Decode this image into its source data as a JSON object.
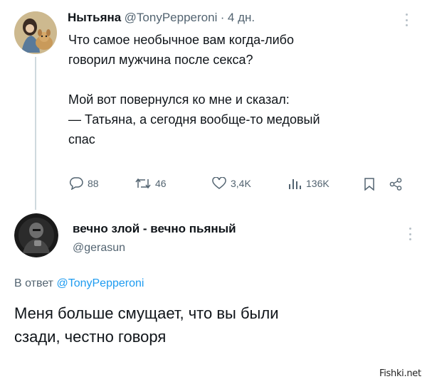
{
  "tweet": {
    "author_name": "Нытьяна",
    "handle": "@TonyPepperoni",
    "separator": "·",
    "time": "4 дн.",
    "lines": [
      "Что самое необычное вам когда-либо",
      "говорил мужчина после секса?",
      "",
      "Мой вот повернулся ко мне и сказал:",
      "— Татьяна, а сегодня вообще-то медовый",
      "спас"
    ],
    "actions": {
      "replies": "88",
      "retweets": "46",
      "likes": "3,4K",
      "views": "136K"
    },
    "icons": [
      "comment-icon",
      "retweet-icon",
      "heart-icon",
      "views-icon",
      "bookmark-icon",
      "share-icon"
    ]
  },
  "reply": {
    "author_name": "вечно злой - вечно пьяный",
    "handle": "@gerasun",
    "replying_prefix": "В ответ",
    "replying_to": "@TonyPepperoni",
    "lines": [
      "Меня больше смущает, что вы были",
      "сзади, честно говоря"
    ]
  },
  "watermark": "Fishki.net",
  "colors": {
    "text": "#0f1419",
    "secondary": "#536471",
    "link": "#1d9bf0",
    "thread_line": "#cfd9de"
  }
}
